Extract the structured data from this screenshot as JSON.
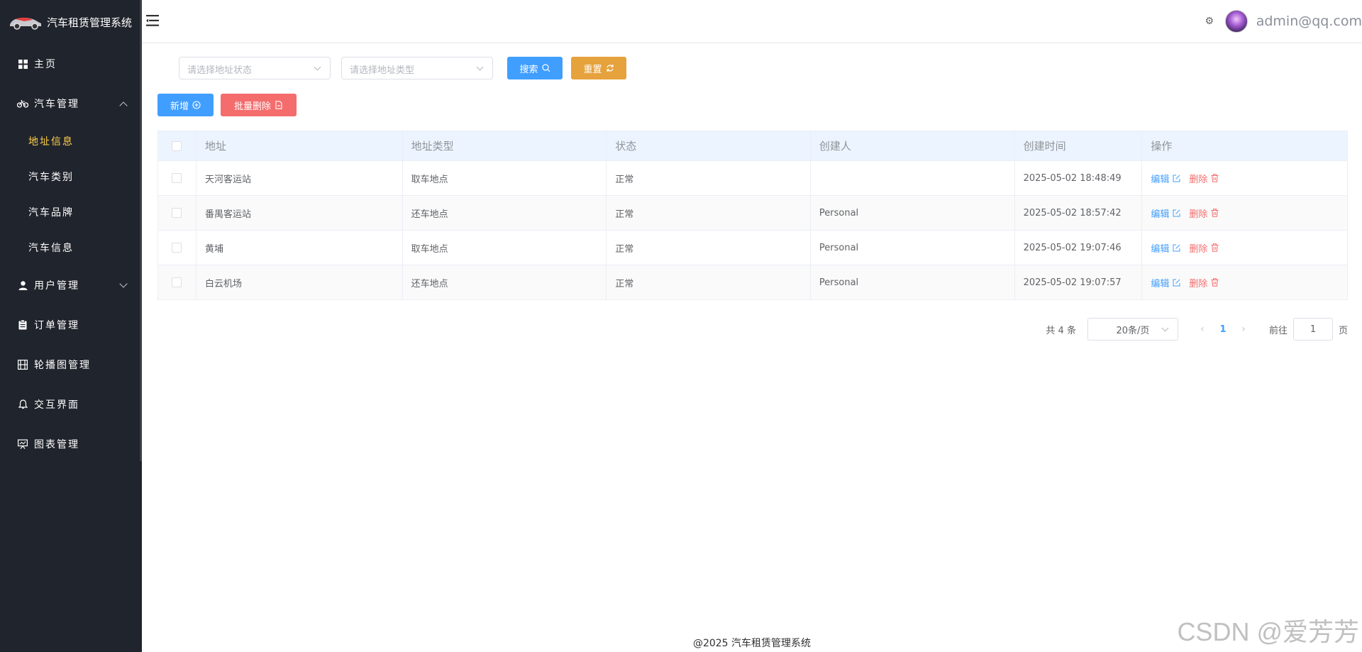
{
  "app": {
    "title": "汽车租赁管理系统"
  },
  "sidebar": {
    "items": [
      {
        "label": "主页",
        "icon": "grid-icon"
      },
      {
        "label": "汽车管理",
        "icon": "bike-icon",
        "expanded": true,
        "children": [
          {
            "label": "地址信息",
            "active": true
          },
          {
            "label": "汽车类别"
          },
          {
            "label": "汽车品牌"
          },
          {
            "label": "汽车信息"
          }
        ]
      },
      {
        "label": "用户管理",
        "icon": "user-icon",
        "expanded": false
      },
      {
        "label": "订单管理",
        "icon": "clipboard-icon"
      },
      {
        "label": "轮播图管理",
        "icon": "film-icon"
      },
      {
        "label": "交互界面",
        "icon": "bell-icon"
      },
      {
        "label": "图表管理",
        "icon": "presentation-icon"
      }
    ],
    "active_color": "#ffd04b",
    "bg_color": "#20242c"
  },
  "header": {
    "user": "admin@qq.com"
  },
  "filters": {
    "status_placeholder": "请选择地址状态",
    "type_placeholder": "请选择地址类型",
    "search_label": "搜索",
    "reset_label": "重置"
  },
  "actions": {
    "add_label": "新增",
    "batch_delete_label": "批量删除"
  },
  "table": {
    "columns": [
      "地址",
      "地址类型",
      "状态",
      "创建人",
      "创建时间",
      "操作"
    ],
    "rows": [
      {
        "address": "天河客运站",
        "type": "取车地点",
        "status": "正常",
        "creator": "",
        "created": "2025-05-02 18:48:49"
      },
      {
        "address": "番禺客运站",
        "type": "还车地点",
        "status": "正常",
        "creator": "Personal",
        "created": "2025-05-02 18:57:42"
      },
      {
        "address": "黄埔",
        "type": "取车地点",
        "status": "正常",
        "creator": "Personal",
        "created": "2025-05-02 19:07:46"
      },
      {
        "address": "白云机场",
        "type": "还车地点",
        "status": "正常",
        "creator": "Personal",
        "created": "2025-05-02 19:07:57"
      }
    ],
    "edit_label": "编辑",
    "delete_label": "删除"
  },
  "pagination": {
    "total_text": "共 4 条",
    "page_size": "20条/页",
    "current_page": "1",
    "goto_label": "前往",
    "goto_value": "1",
    "page_suffix": "页"
  },
  "footer": {
    "text": "@2025 汽车租赁管理系统"
  },
  "watermark": "CSDN @爱芳芳",
  "colors": {
    "primary": "#409eff",
    "warning": "#e6a23c",
    "danger": "#f56c6c"
  }
}
